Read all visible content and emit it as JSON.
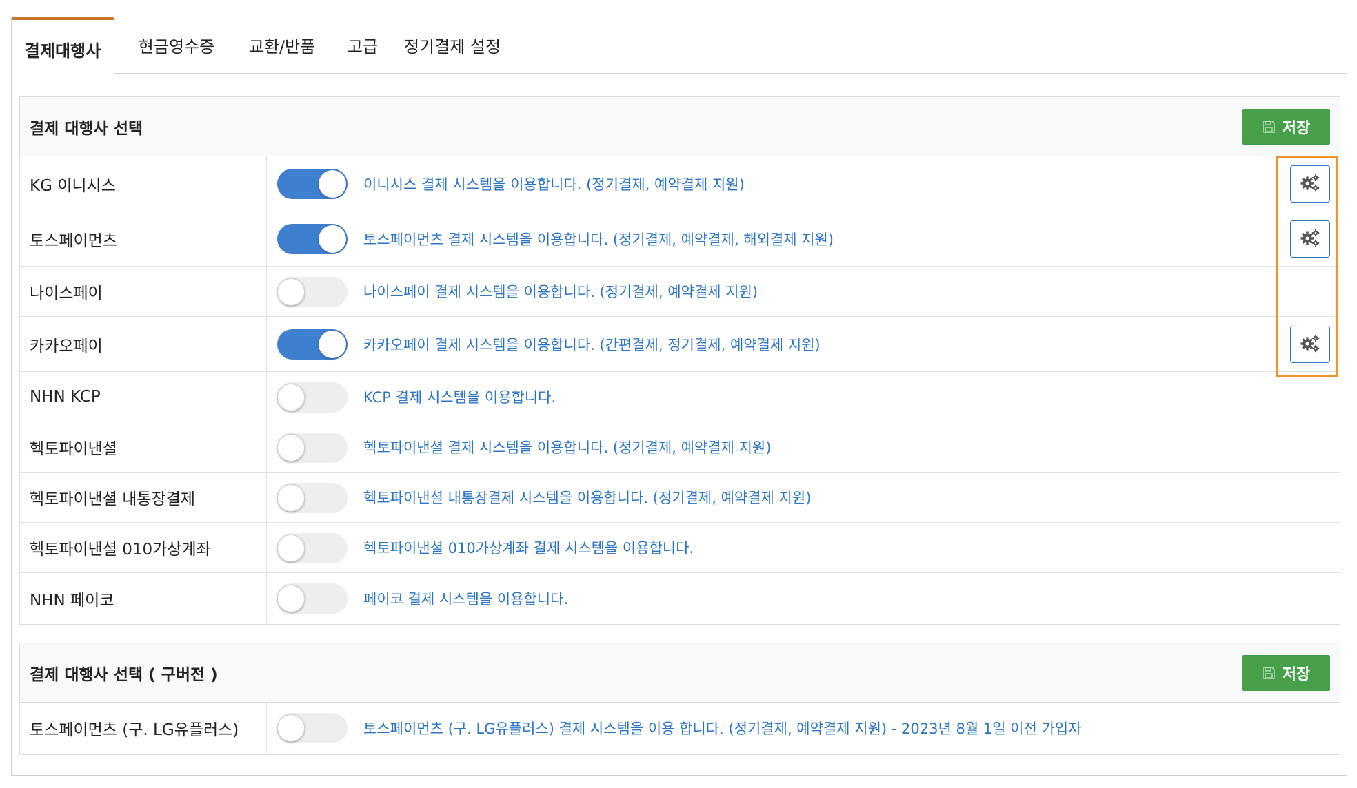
{
  "tabs": [
    {
      "label": "결제대행사",
      "active": true
    },
    {
      "label": "현금영수증",
      "active": false
    },
    {
      "label": "교환/반품",
      "active": false
    },
    {
      "label": "고급",
      "active": false
    },
    {
      "label": "정기결제 설정",
      "active": false
    }
  ],
  "panel_main": {
    "title": "결제 대행사 선택",
    "save_label": "저장",
    "rows": [
      {
        "name": "KG 이니시스",
        "enabled": true,
        "desc": "이니시스 결제 시스템을 이용합니다. (정기결제, 예약결제 지원)",
        "has_settings": true
      },
      {
        "name": "토스페이먼츠",
        "enabled": true,
        "desc": "토스페이먼츠 결제 시스템을 이용합니다. (정기결제, 예약결제, 해외결제 지원)",
        "has_settings": true
      },
      {
        "name": "나이스페이",
        "enabled": false,
        "desc": "나이스페이 결제 시스템을 이용합니다. (정기결제, 예약결제 지원)",
        "has_settings": false
      },
      {
        "name": "카카오페이",
        "enabled": true,
        "desc": "카카오페이 결제 시스템을 이용합니다. (간편결제, 정기결제, 예약결제 지원)",
        "has_settings": true
      },
      {
        "name": "NHN KCP",
        "enabled": false,
        "desc": "KCP 결제 시스템을 이용합니다.",
        "has_settings": false
      },
      {
        "name": "헥토파이낸셜",
        "enabled": false,
        "desc": "헥토파이낸셜 결제 시스템을 이용합니다. (정기결제, 예약결제 지원)",
        "has_settings": false
      },
      {
        "name": "헥토파이낸셜 내통장결제",
        "enabled": false,
        "desc": "헥토파이낸셜 내통장결제 시스템을 이용합니다. (정기결제, 예약결제 지원)",
        "has_settings": false
      },
      {
        "name": "헥토파이낸셜 010가상계좌",
        "enabled": false,
        "desc": "헥토파이낸셜 010가상계좌 결제 시스템을 이용합니다.",
        "has_settings": false
      },
      {
        "name": "NHN 페이코",
        "enabled": false,
        "desc": "페이코 결제 시스템을 이용합니다.",
        "has_settings": false
      }
    ]
  },
  "panel_legacy": {
    "title": "결제 대행사 선택 ( 구버전 )",
    "save_label": "저장",
    "rows": [
      {
        "name": "토스페이먼츠 (구. LG유플러스)",
        "enabled": false,
        "desc": "토스페이먼츠 (구. LG유플러스) 결제 시스템을 이용 합니다. (정기결제, 예약결제 지원) - 2023년 8월 1일 이전 가입자",
        "has_settings": false
      }
    ]
  },
  "colors": {
    "accent_tab": "#c9742f",
    "toggle_on": "#3f7fd0",
    "link_text": "#2a74c6",
    "save_button": "#45a049",
    "highlight": "#f0932b"
  },
  "icons": {
    "save": "floppy-disk-icon",
    "settings": "gears-icon"
  }
}
